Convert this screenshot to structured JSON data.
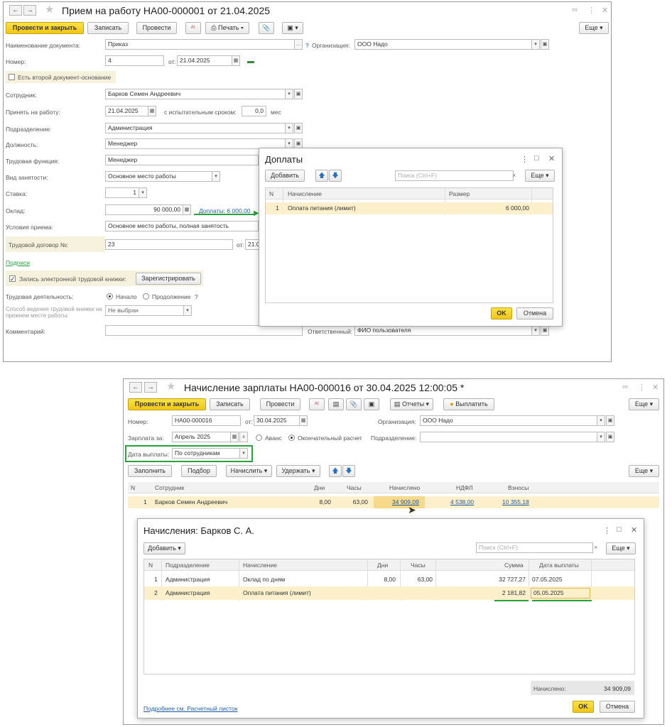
{
  "w1": {
    "title": "Прием на работу НА00-000001 от 21.04.2025",
    "toolbar": {
      "post_close": "Провести и закрыть",
      "save": "Записать",
      "post": "Провести",
      "print": "Печать",
      "more": "Еще"
    },
    "doc_name_label": "Наименование документа:",
    "doc_name_value": "Приказ",
    "org_label": "Организация:",
    "org_value": "ООО Надо",
    "number_label": "Номер:",
    "number_value": "4",
    "date_from_label": "от:",
    "date_value": "21.04.2025",
    "second_doc_label": "Есть второй документ-основание",
    "employee_label": "Сотрудник:",
    "employee_value": "Барков Семен Андреевич",
    "hire_label": "Принять на работу:",
    "hire_value": "21.04.2025",
    "probation_label": "с испытательным сроком:",
    "probation_value": "0,0",
    "probation_unit": "мес",
    "dept_label": "Подразделение:",
    "dept_value": "Администрация",
    "position_label": "Должность:",
    "position_value": "Менеджер",
    "function_label": "Трудовая функция:",
    "function_value": "Менеджер",
    "employment_label": "Вид занятости:",
    "employment_value": "Основное место работы",
    "rate_label": "Ставка:",
    "rate_value": "1",
    "salary_label": "Оклад:",
    "salary_value": "90 000,00",
    "surcharges_link": "Доплаты: 6 000,00",
    "conditions_label": "Условия приема:",
    "conditions_value": "Основное место работы, полная занятость",
    "contract_label": "Трудовой договор №:",
    "contract_value": "23",
    "contract_from_label": "от:",
    "contract_date_partial": "21.0",
    "signatures_link": "Подписи",
    "electronic_book_label": "Запись электронной трудовой книжки:",
    "register_button": "Зарегистрировать",
    "labor_activity_label": "Трудовая деятельность:",
    "radio_start": "Начало",
    "radio_continue": "Продолжение",
    "help_mark": "?",
    "book_method_label": "Способ ведения трудовой книжки на прежнем месте работы:",
    "book_method_value": "Не выбран",
    "comment_label": "Комментарий:",
    "responsible_label": "Ответственный:",
    "responsible_value": "ФИО пользователя"
  },
  "popup1": {
    "title": "Доплаты",
    "add": "Добавить",
    "search_placeholder": "Поиск (Ctrl+F)",
    "more": "Еще",
    "columns": [
      "N",
      "Начисление",
      "Размер"
    ],
    "rows": [
      {
        "n": "1",
        "accrual": "Оплата питания (лимит)",
        "amount": "6 000,00"
      }
    ],
    "ok": "OK",
    "cancel": "Отмена"
  },
  "w2": {
    "title": "Начисление зарплаты НА00-000016 от 30.04.2025 12:00:05 *",
    "toolbar": {
      "post_close": "Провести и закрыть",
      "save": "Записать",
      "post": "Провести",
      "reports": "Отчеты",
      "pay": "Выплатить",
      "more": "Еще"
    },
    "number_label": "Номер:",
    "number_value": "НА00-000016",
    "date_from_label": "от:",
    "date_value": "30.04.2025",
    "org_label": "Организация:",
    "org_value": "ООО Надо",
    "salary_for_label": "Зарплата за:",
    "salary_for_value": "Апрель 2025",
    "radio_advance": "Аванс",
    "radio_final": "Окончательный расчет",
    "dept_label": "Подразделение:",
    "pay_date_label": "Дата выплаты:",
    "pay_date_value": "По сотрудникам",
    "actions": {
      "fill": "Заполнить",
      "pick": "Подбор",
      "accrue": "Начислить",
      "withhold": "Удержать",
      "more": "Еще"
    },
    "columns": [
      "N",
      "Сотрудник",
      "Дни",
      "Часы",
      "Начислено",
      "НДФЛ",
      "Взносы"
    ],
    "rows": [
      {
        "n": "1",
        "employee": "Барков Семен Андреевич",
        "days": "8,00",
        "hours": "63,00",
        "accrued": "34 909,09",
        "ndfl": "4 538,00",
        "contrib": "10 355,18"
      }
    ]
  },
  "popup2": {
    "title": "Начисления: Барков С. А.",
    "add": "Добавить",
    "search_placeholder": "Поиск (Ctrl+F)",
    "more": "Еще",
    "columns": [
      "N",
      "Подразделение",
      "Начисление",
      "Дни",
      "Часы",
      "Сумма",
      "Дата выплаты"
    ],
    "rows": [
      {
        "n": "1",
        "dept": "Администрация",
        "accrual": "Оклад по дням",
        "days": "8,00",
        "hours": "63,00",
        "sum": "32 727,27",
        "pay_date": "07.05.2025"
      },
      {
        "n": "2",
        "dept": "Администрация",
        "accrual": "Оплата питания (лимит)",
        "days": "",
        "hours": "",
        "sum": "2 181,82",
        "pay_date": "05.05.2025"
      }
    ],
    "total_label": "Начислено:",
    "total_value": "34 909,09",
    "details_link": "Подробнее см. Расчетный листок",
    "ok": "OK",
    "cancel": "Отмена"
  }
}
